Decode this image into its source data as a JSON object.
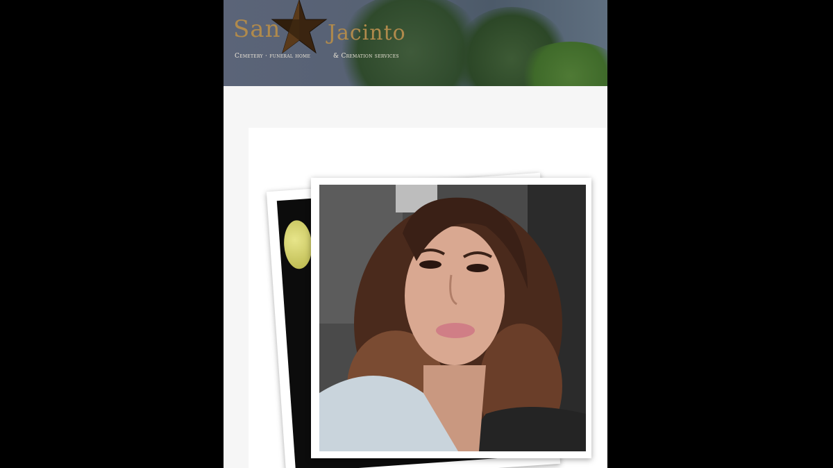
{
  "header": {
    "logo_word_left": "San",
    "logo_word_right": "Jacinto",
    "logo_sub_left": "Cemetery · funeral home",
    "logo_sub_right": "& Cremation services",
    "logo_icon": "star-icon",
    "brand_color": "#b08a4c"
  },
  "photos": {
    "back_photo_icon": "photo",
    "front_photo_icon": "portrait-photo"
  }
}
